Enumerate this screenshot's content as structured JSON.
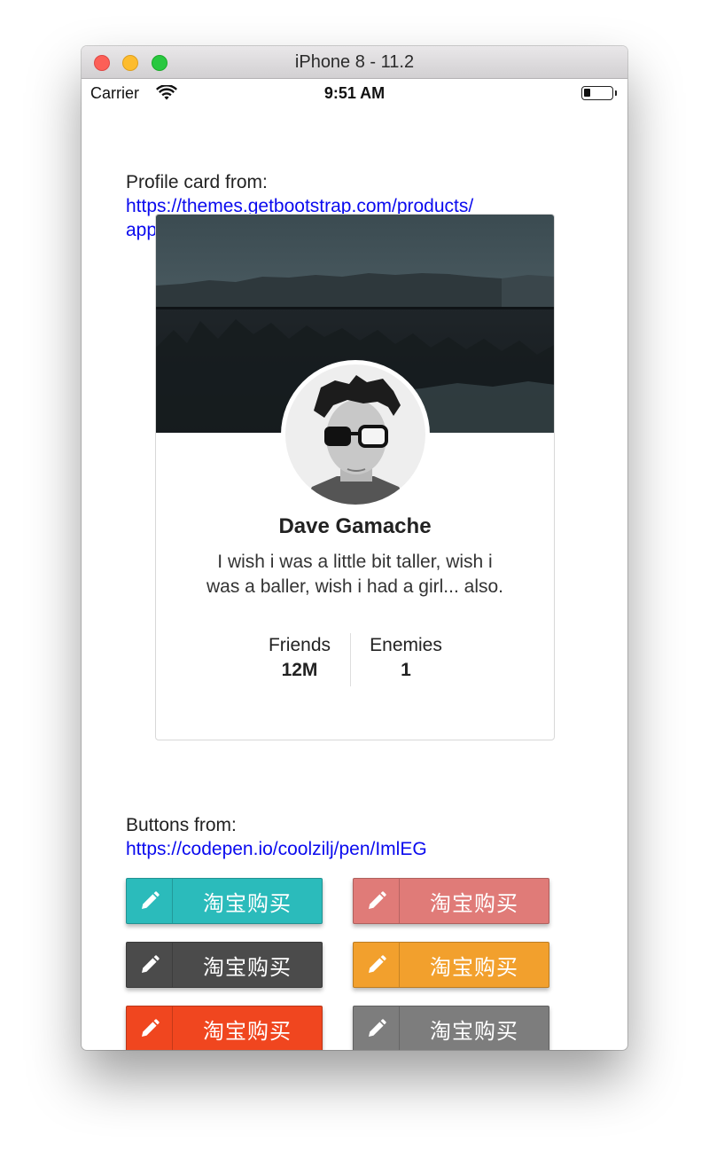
{
  "window": {
    "title": "iPhone 8 - 11.2"
  },
  "status_bar": {
    "carrier": "Carrier",
    "time": "9:51 AM",
    "battery_level": 0.25
  },
  "profile_section": {
    "label": "Profile card from:",
    "link_line1": "https://themes.getbootstrap.com/products/",
    "link_line2": "application"
  },
  "profile_card": {
    "name": "Dave Gamache",
    "bio_line1": "I wish i was a little bit taller, wish i",
    "bio_line2": "was a baller, wish i had a girl... also.",
    "stats": [
      {
        "label": "Friends",
        "value": "12M"
      },
      {
        "label": "Enemies",
        "value": "1"
      }
    ]
  },
  "buttons_section": {
    "label": "Buttons from:",
    "link": "https://codepen.io/coolzilj/pen/ImlEG"
  },
  "buttons": [
    {
      "label": "淘宝购买",
      "icon": "pencil-icon",
      "color": "#2bbbbb"
    },
    {
      "label": "淘宝购买",
      "icon": "pencil-icon",
      "color": "#e07b78"
    },
    {
      "label": "淘宝购买",
      "icon": "pencil-icon",
      "color": "#4b4b4b"
    },
    {
      "label": "淘宝购买",
      "icon": "pencil-icon",
      "color": "#f2a02d"
    },
    {
      "label": "淘宝购买",
      "icon": "pencil-icon",
      "color": "#f0461f"
    },
    {
      "label": "淘宝购买",
      "icon": "pencil-icon",
      "color": "#7d7d7d"
    }
  ]
}
